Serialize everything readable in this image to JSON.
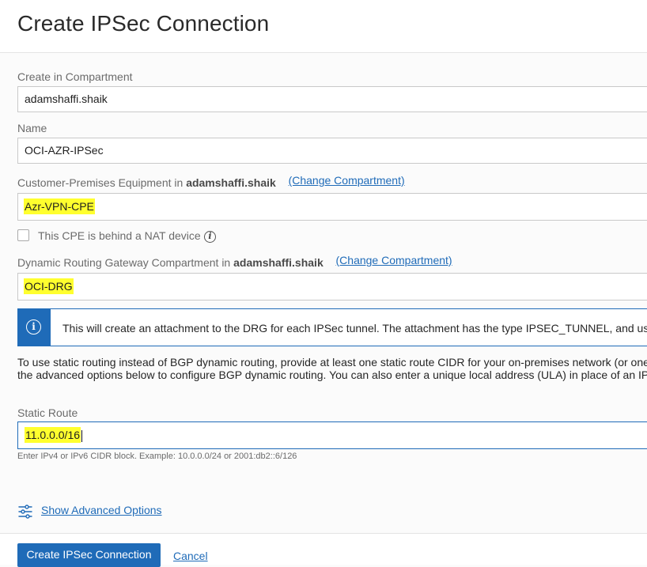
{
  "header": {
    "title": "Create IPSec Connection"
  },
  "compartment": {
    "label": "Create in Compartment",
    "value": "adamshaffi.shaik"
  },
  "name": {
    "label": "Name",
    "value": "OCI-AZR-IPSec"
  },
  "cpe": {
    "label_prefix": "Customer-Premises Equipment in",
    "label_bold": "adamshaffi.shaik",
    "change_link": "(Change Compartment)",
    "value": "Azr-VPN-CPE"
  },
  "nat": {
    "label": "This CPE is behind a NAT device",
    "checked": false
  },
  "drg": {
    "label_prefix": "Dynamic Routing Gateway Compartment in",
    "label_bold": "adamshaffi.shaik",
    "change_link": "(Change Compartment)",
    "value": "OCI-DRG"
  },
  "banner": {
    "text": "This will create an attachment to the DRG for each IPSec tunnel. The attachment has the type IPSEC_TUNNEL, and us"
  },
  "routing_note": {
    "line1": "To use static routing instead of BGP dynamic routing, provide at least one static route CIDR for your on-premises network (or one",
    "line2": "the advanced options below to configure BGP dynamic routing. You can also enter a unique local address (ULA) in place of an IP"
  },
  "static_route": {
    "label": "Static Route",
    "value": "11.0.0.0/16",
    "hint": "Enter IPv4 or IPv6 CIDR block. Example: 10.0.0.0/24 or 2001:db2::6/126"
  },
  "advanced": {
    "label": "Show Advanced Options"
  },
  "footer": {
    "primary_label": "Create IPSec Connection",
    "cancel_label": "Cancel"
  },
  "colors": {
    "accent": "#1f6bb8",
    "highlight": "#ffff2e"
  }
}
